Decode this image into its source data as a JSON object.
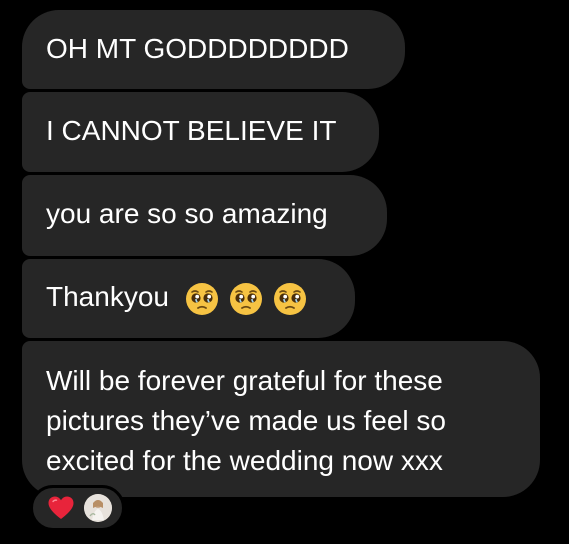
{
  "messages": [
    {
      "text": "OH MT GODDDDDDDD"
    },
    {
      "text": "I CANNOT BELIEVE IT"
    },
    {
      "text": "you are so so amazing"
    },
    {
      "text": "Thankyou",
      "emojis": [
        "pleading-face-icon",
        "pleading-face-icon",
        "pleading-face-icon"
      ]
    },
    {
      "lines": [
        "Will be forever grateful for these",
        "pictures they’ve made us feel so",
        "excited for the wedding now xxx"
      ]
    }
  ],
  "reactions": {
    "items": [
      "heart-icon"
    ],
    "reactor": "avatar"
  },
  "colors": {
    "background": "#000000",
    "bubble": "#262626",
    "text": "#ffffff",
    "heart": "#e8243b"
  }
}
